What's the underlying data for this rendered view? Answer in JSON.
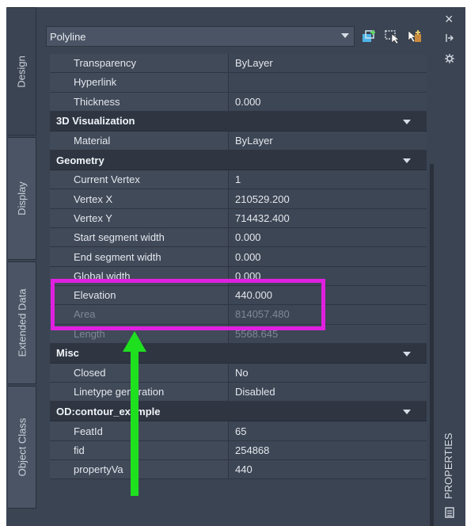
{
  "left_tabs": [
    {
      "label": "Design"
    },
    {
      "label": "Display"
    },
    {
      "label": "Extended Data"
    },
    {
      "label": "Object Class"
    }
  ],
  "header": {
    "object_type": "Polyline",
    "tool_icons": [
      "quick-select-icon",
      "select-objects-icon",
      "toggle-pickadd-icon"
    ]
  },
  "rows": [
    {
      "kind": "prop",
      "name": "Transparency",
      "value": "ByLayer"
    },
    {
      "kind": "prop",
      "name": "Hyperlink",
      "value": ""
    },
    {
      "kind": "prop",
      "name": "Thickness",
      "value": "0.000"
    },
    {
      "kind": "cat",
      "name": "3D Visualization"
    },
    {
      "kind": "prop",
      "name": "Material",
      "value": "ByLayer"
    },
    {
      "kind": "cat",
      "name": "Geometry"
    },
    {
      "kind": "prop",
      "name": "Current Vertex",
      "value": "1"
    },
    {
      "kind": "prop",
      "name": "Vertex X",
      "value": "210529.200"
    },
    {
      "kind": "prop",
      "name": "Vertex Y",
      "value": "714432.400"
    },
    {
      "kind": "prop",
      "name": "Start segment width",
      "value": "0.000"
    },
    {
      "kind": "prop",
      "name": "End segment width",
      "value": "0.000"
    },
    {
      "kind": "prop",
      "name": "Global width",
      "value": "0.000"
    },
    {
      "kind": "prop",
      "name": "Elevation",
      "value": "440.000"
    },
    {
      "kind": "prop",
      "name": "Area",
      "value": "814057.480",
      "dim": true
    },
    {
      "kind": "prop",
      "name": "Length",
      "value": "5568.645",
      "dim": true
    },
    {
      "kind": "cat",
      "name": "Misc"
    },
    {
      "kind": "prop",
      "name": "Closed",
      "value": "No"
    },
    {
      "kind": "prop",
      "name": "Linetype generation",
      "value": "Disabled"
    },
    {
      "kind": "cat",
      "name": "OD:contour_example"
    },
    {
      "kind": "prop",
      "name": "FeatId",
      "value": "65"
    },
    {
      "kind": "prop",
      "name": "fid",
      "value": "254868"
    },
    {
      "kind": "prop",
      "name": "propertyVa",
      "value": "440"
    }
  ],
  "right_bar": {
    "close": "×",
    "label": "PROPERTIES"
  },
  "colors": {
    "highlight": "#e020e0",
    "arrow": "#1fe01f",
    "panel": "#3b4453"
  }
}
